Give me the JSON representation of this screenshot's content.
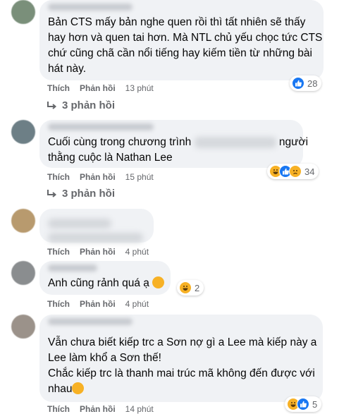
{
  "labels": {
    "like": "Thích",
    "reply": "Phản hồi"
  },
  "comments": [
    {
      "lines": [
        "Bản CTS mấy bản nghe quen rồi thì tất nhiên sẽ thấy",
        "hay hơn và quen tai hơn. Mà NTL chủ yếu chọc tức CTS",
        "chứ cũng chã cần nổi tiếng hay kiếm tiền từ những bài",
        "hát này."
      ],
      "time": "13 phút",
      "reactions": {
        "icons": [
          "like"
        ],
        "count": "28"
      },
      "replies": "3 phản hồi"
    },
    {
      "line1_start": "Cuối cùng trong chương trình",
      "line1_end": "người",
      "line2": "thằng cuộc là Nathan Lee",
      "time": "15 phút",
      "reactions": {
        "icons": [
          "haha",
          "like",
          "sad"
        ],
        "count": "34"
      },
      "replies": "3 phản hồi"
    },
    {
      "time": "4 phút"
    },
    {
      "text": "Anh cũng rảnh quá ạ",
      "time": "4 phút",
      "reactions": {
        "icons": [
          "haha"
        ],
        "count": "2"
      }
    },
    {
      "lines": [
        "Vẫn chưa biết kiếp trc a Sơn nợ gì a Lee mà kiếp này a",
        "Lee làm khổ a Sơn thế!",
        "Chắc kiếp trc là thanh mai trúc mã không đến được với"
      ],
      "last_line": "nhau",
      "time": "14 phút",
      "reactions": {
        "icons": [
          "haha",
          "like"
        ],
        "count": "5"
      }
    }
  ],
  "colors": {
    "bubble": "#f0f2f5",
    "meta": "#65676b",
    "like": "#1877f2",
    "haha": "#f7b125"
  }
}
